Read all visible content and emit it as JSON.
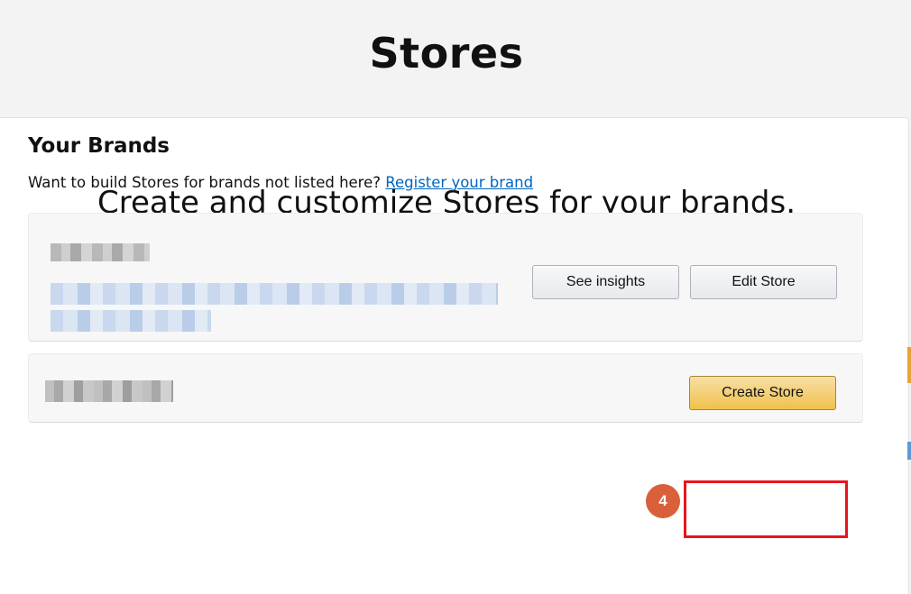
{
  "header": {
    "title": "Stores"
  },
  "main": {
    "headline": "Create and customize Stores for your brands.",
    "section_title": "Your Brands",
    "description": "Want to build Stores for brands not listed here?",
    "register_link": "Register your brand"
  },
  "brands": [
    {
      "see_insights_label": "See insights",
      "edit_store_label": "Edit Store"
    },
    {
      "create_store_label": "Create Store"
    }
  ],
  "annotation": {
    "step_number": "4"
  },
  "colors": {
    "link": "#0066c0",
    "primary_button": "#f0c14b",
    "highlight_border": "#e8141e",
    "step_badge": "#d9603b"
  }
}
